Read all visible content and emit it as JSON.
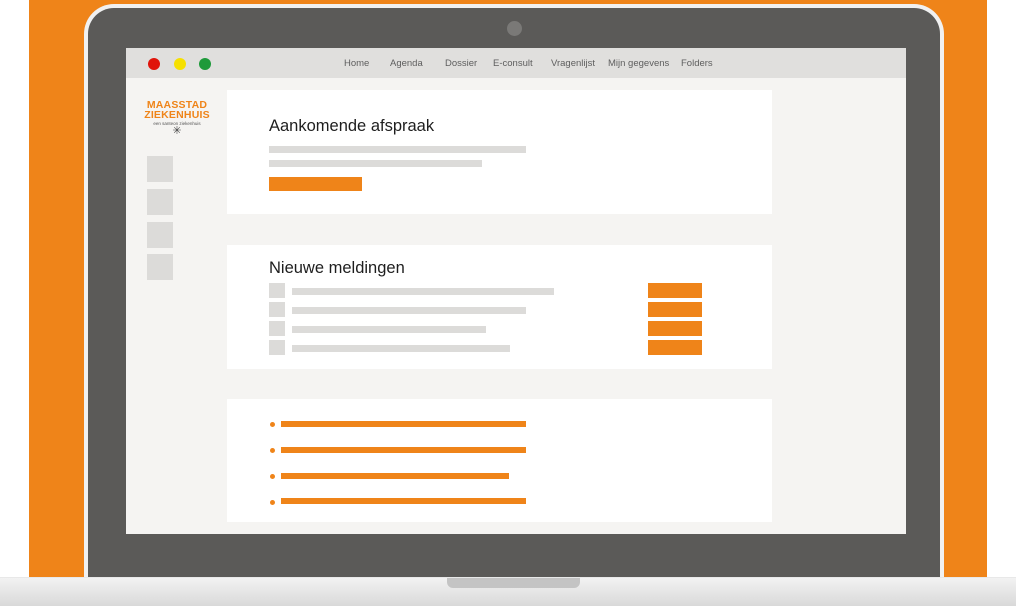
{
  "brand": {
    "accent": "#ef8419",
    "lid": "#5b5a58",
    "screen_bg": "#f5f4f2"
  },
  "window": {
    "controls": [
      {
        "name": "close",
        "color": "#e0150b"
      },
      {
        "name": "minimize",
        "color": "#f6e000"
      },
      {
        "name": "maximize",
        "color": "#1e9a3a"
      }
    ]
  },
  "nav": {
    "items": [
      "Home",
      "Agenda",
      "Dossier",
      "E-consult",
      "Vragenlijst",
      "Mijn gegevens",
      "Folders"
    ]
  },
  "logo": {
    "line1": "MAASSTAD",
    "line2": "ZIEKENHUIS",
    "tagline": "een santeon ziekenhuis",
    "mark": "✳"
  },
  "sidebar": {
    "tile_count": 4
  },
  "appointment": {
    "title": "Aankomende afspraak"
  },
  "notifications": {
    "title": "Nieuwe meldingen",
    "row_count": 4
  },
  "links": {
    "item_count": 4
  }
}
